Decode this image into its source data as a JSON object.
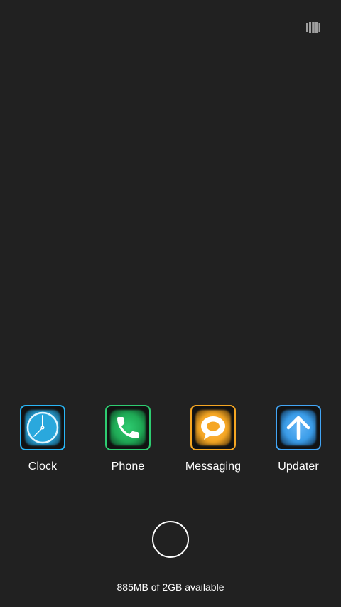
{
  "topbar": {
    "icon": "recent-apps-icon"
  },
  "apps": [
    {
      "label": "Clock",
      "icon": "clock-icon",
      "color": "#29b6f6"
    },
    {
      "label": "Phone",
      "icon": "phone-icon",
      "color": "#2ecc71"
    },
    {
      "label": "Messaging",
      "icon": "message-bubble-icon",
      "color": "#f5a623"
    },
    {
      "label": "Updater",
      "icon": "arrow-up-icon",
      "color": "#42a5f5"
    }
  ],
  "home": {
    "icon": "home-circle-icon"
  },
  "storage": {
    "text": "885MB of 2GB available"
  },
  "colors": {
    "background": "#212121",
    "text": "#ffffff"
  }
}
